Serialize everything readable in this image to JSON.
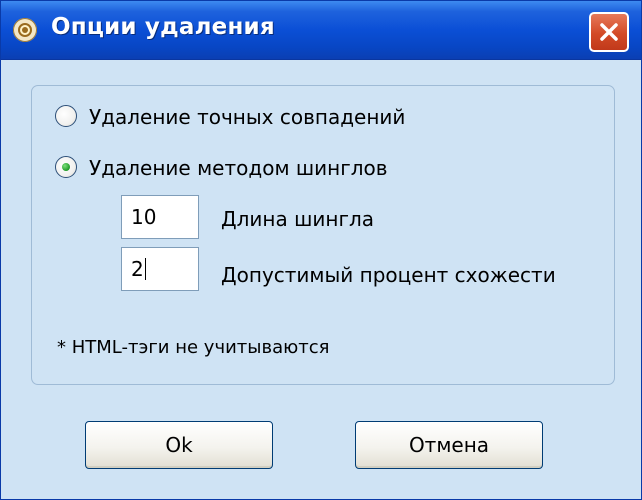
{
  "window": {
    "title": "Опции удаления",
    "app_icon": "app-target-icon",
    "close_icon": "close-x-icon"
  },
  "options": {
    "exact_match_label": "Удаление точных совпадений",
    "exact_match_selected": false,
    "shingles_label": "Удаление методом шинглов",
    "shingles_selected": true
  },
  "fields": {
    "shingle_length_value": "10",
    "shingle_length_label": "Длина шингла",
    "similarity_value": "2",
    "similarity_label": "Допустимый процент схожести"
  },
  "note": "* HTML-тэги не учитываются",
  "buttons": {
    "ok_label": "Ok",
    "cancel_label": "Отмена"
  },
  "colors": {
    "title_bar": "#0b4fd6",
    "dialog_bg": "#cfe3f4",
    "close_button": "#d34a26",
    "radio_selected_dot": "#1f9a28"
  }
}
